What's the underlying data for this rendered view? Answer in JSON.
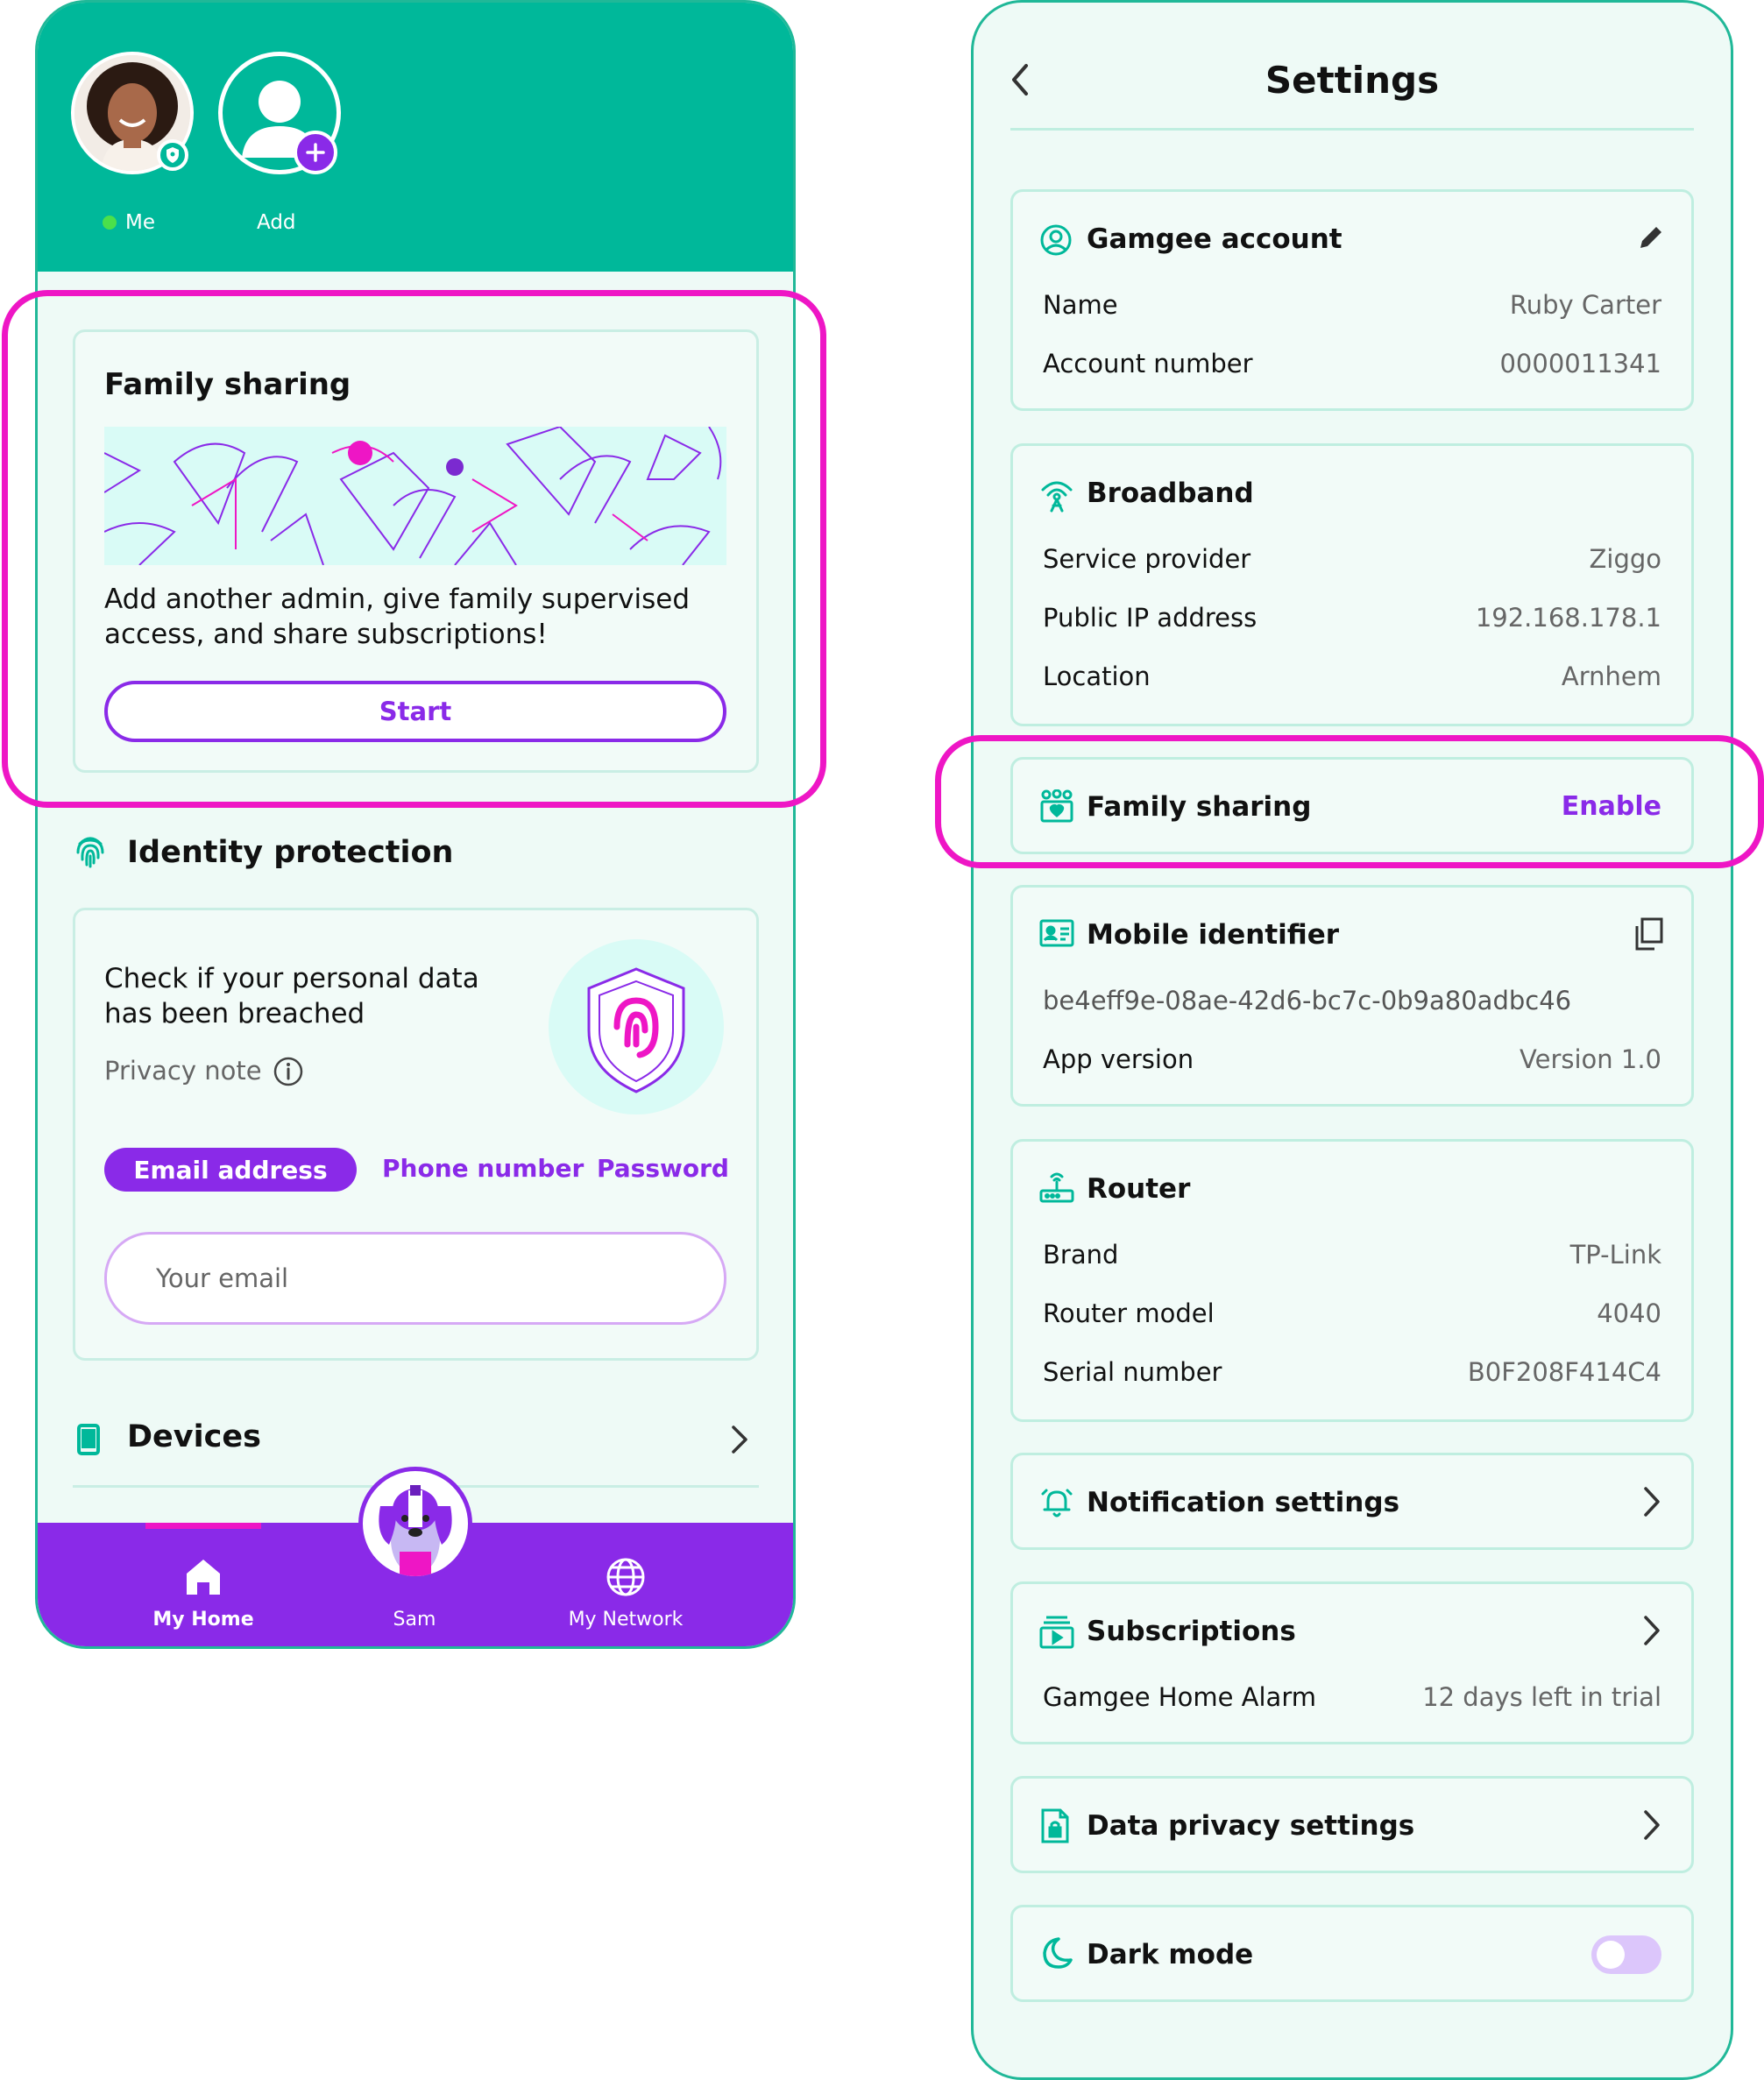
{
  "left_screen": {
    "profiles": [
      {
        "label": "Me",
        "status": "online"
      },
      {
        "label": "Add"
      }
    ],
    "family_card": {
      "title": "Family sharing",
      "description_line1": "Add another admin, give family supervised",
      "description_line2": "access, and share subscriptions!",
      "start_label": "Start"
    },
    "identity": {
      "section_title": "Identity protection",
      "check_line1": "Check if your personal data",
      "check_line2": "has been breached",
      "privacy_note": "Privacy note",
      "tabs": [
        "Email address",
        "Phone number",
        "Password"
      ],
      "active_tab": "Email address",
      "email_placeholder": "Your email"
    },
    "devices_title": "Devices",
    "nav": {
      "home": "My Home",
      "center": "Sam",
      "network": "My Network"
    }
  },
  "right_screen": {
    "title": "Settings",
    "account": {
      "title": "Gamgee account",
      "rows": [
        {
          "k": "Name",
          "v": "Ruby Carter"
        },
        {
          "k": "Account number",
          "v": "0000011341"
        }
      ]
    },
    "broadband": {
      "title": "Broadband",
      "rows": [
        {
          "k": "Service provider",
          "v": "Ziggo"
        },
        {
          "k": "Public IP address",
          "v": "192.168.178.1"
        },
        {
          "k": "Location",
          "v": "Arnhem"
        }
      ]
    },
    "family": {
      "title": "Family sharing",
      "action": "Enable"
    },
    "mobile": {
      "title": "Mobile identifier",
      "id": "be4eff9e-08ae-42d6-bc7c-0b9a80adbc46",
      "rows": [
        {
          "k": "App version",
          "v": "Version 1.0"
        }
      ]
    },
    "router": {
      "title": "Router",
      "rows": [
        {
          "k": "Brand",
          "v": "TP-Link"
        },
        {
          "k": "Router model",
          "v": "4040"
        },
        {
          "k": "Serial number",
          "v": "B0F208F414C4"
        }
      ]
    },
    "notifications": {
      "title": "Notification settings"
    },
    "subscriptions": {
      "title": "Subscriptions",
      "rows": [
        {
          "k": "Gamgee Home Alarm",
          "v": "12 days left in trial"
        }
      ]
    },
    "privacy": {
      "title": "Data privacy settings"
    },
    "dark_mode": {
      "title": "Dark mode",
      "enabled": false
    }
  },
  "colors": {
    "teal": "#00b89a",
    "purple": "#8a2ae8",
    "highlight": "#ee16c5",
    "background": "#eefaf6"
  },
  "icons": [
    "shield-badge-icon",
    "person-icon",
    "plus-icon",
    "fingerprint-icon",
    "info-icon",
    "phone-icon",
    "chevron-right-icon",
    "home-icon",
    "globe-icon",
    "dog-mascot-icon",
    "back-chevron-icon",
    "account-icon",
    "pencil-icon",
    "broadband-icon",
    "family-icon",
    "id-card-icon",
    "copy-icon",
    "router-icon",
    "bell-icon",
    "subscriptions-icon",
    "document-lock-icon",
    "moon-icon"
  ]
}
